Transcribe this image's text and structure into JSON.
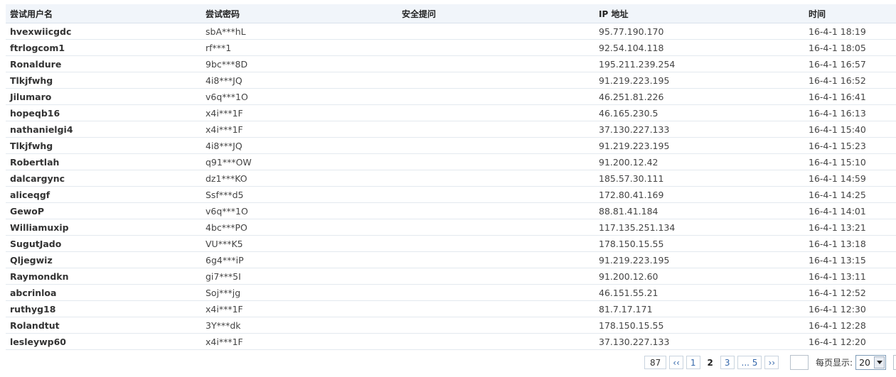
{
  "table": {
    "headers": [
      "尝试用户名",
      "尝试密码",
      "安全提问",
      "IP 地址",
      "时间"
    ],
    "rows": [
      {
        "user": "hvexwiicgdc",
        "pass": "sbA***hL",
        "question": "",
        "ip": "95.77.190.170",
        "time": "16-4-1 18:19"
      },
      {
        "user": "ftrlogcom1",
        "pass": "rf***1",
        "question": "",
        "ip": "92.54.104.118",
        "time": "16-4-1 18:05"
      },
      {
        "user": "Ronaldure",
        "pass": "9bc***8D",
        "question": "",
        "ip": "195.211.239.254",
        "time": "16-4-1 16:57"
      },
      {
        "user": "Tlkjfwhg",
        "pass": "4i8***JQ",
        "question": "",
        "ip": "91.219.223.195",
        "time": "16-4-1 16:52"
      },
      {
        "user": "Jilumaro",
        "pass": "v6q***1O",
        "question": "",
        "ip": "46.251.81.226",
        "time": "16-4-1 16:41"
      },
      {
        "user": "hopeqb16",
        "pass": "x4i***1F",
        "question": "",
        "ip": "46.165.230.5",
        "time": "16-4-1 16:13"
      },
      {
        "user": "nathanielgi4",
        "pass": "x4i***1F",
        "question": "",
        "ip": "37.130.227.133",
        "time": "16-4-1 15:40"
      },
      {
        "user": "Tlkjfwhg",
        "pass": "4i8***JQ",
        "question": "",
        "ip": "91.219.223.195",
        "time": "16-4-1 15:23"
      },
      {
        "user": "Robertlah",
        "pass": "q91***OW",
        "question": "",
        "ip": "91.200.12.42",
        "time": "16-4-1 15:10"
      },
      {
        "user": "dalcargync",
        "pass": "dz1***KO",
        "question": "",
        "ip": "185.57.30.111",
        "time": "16-4-1 14:59"
      },
      {
        "user": "aliceqgf",
        "pass": "Ssf***d5",
        "question": "",
        "ip": "172.80.41.169",
        "time": "16-4-1 14:25"
      },
      {
        "user": "GewoP",
        "pass": "v6q***1O",
        "question": "",
        "ip": "88.81.41.184",
        "time": "16-4-1 14:01"
      },
      {
        "user": "Williamuxip",
        "pass": "4bc***PO",
        "question": "",
        "ip": "117.135.251.134",
        "time": "16-4-1 13:21"
      },
      {
        "user": "SugutJado",
        "pass": "VU***K5",
        "question": "",
        "ip": "178.150.15.55",
        "time": "16-4-1 13:18"
      },
      {
        "user": "Qljegwiz",
        "pass": "6g4***iP",
        "question": "",
        "ip": "91.219.223.195",
        "time": "16-4-1 13:15"
      },
      {
        "user": "Raymondkn",
        "pass": "gi7***5I",
        "question": "",
        "ip": "91.200.12.60",
        "time": "16-4-1 13:11"
      },
      {
        "user": "abcrinloa",
        "pass": "Soj***jg",
        "question": "",
        "ip": "46.151.55.21",
        "time": "16-4-1 12:52"
      },
      {
        "user": "ruthyg18",
        "pass": "x4i***1F",
        "question": "",
        "ip": "81.7.17.171",
        "time": "16-4-1 12:30"
      },
      {
        "user": "Rolandtut",
        "pass": "3Y***dk",
        "question": "",
        "ip": "178.150.15.55",
        "time": "16-4-1 12:28"
      },
      {
        "user": "lesleywp60",
        "pass": "x4i***1F",
        "question": "",
        "ip": "37.130.227.133",
        "time": "16-4-1 12:20"
      }
    ]
  },
  "pager": {
    "total": "87",
    "first": "‹‹",
    "pages": [
      "1",
      "2",
      "3"
    ],
    "current": "2",
    "last": "... 5",
    "next": "››",
    "per_page_label": "每页显示:",
    "per_page_value": "20"
  },
  "icons": {
    "dropdown": "chevron-down-icon"
  }
}
